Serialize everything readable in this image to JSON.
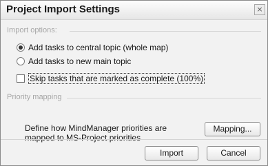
{
  "dialog": {
    "title": "Project Import Settings",
    "close_glyph": "×"
  },
  "import_options": {
    "label": "Import options:",
    "radio_central": "Add tasks to central topic (whole map)",
    "radio_new": "Add tasks to new main topic",
    "checkbox_skip": "Skip tasks that are marked as complete (100%)"
  },
  "priority_mapping": {
    "label": "Priority mapping",
    "description_line1": "Define how MindManager priorities are",
    "description_line2": "mapped to MS-Project priorities",
    "mapping_button": "Mapping..."
  },
  "footer": {
    "import_button": "Import",
    "cancel_button": "Cancel"
  },
  "state": {
    "selected_radio": "central",
    "skip_checked": false
  }
}
